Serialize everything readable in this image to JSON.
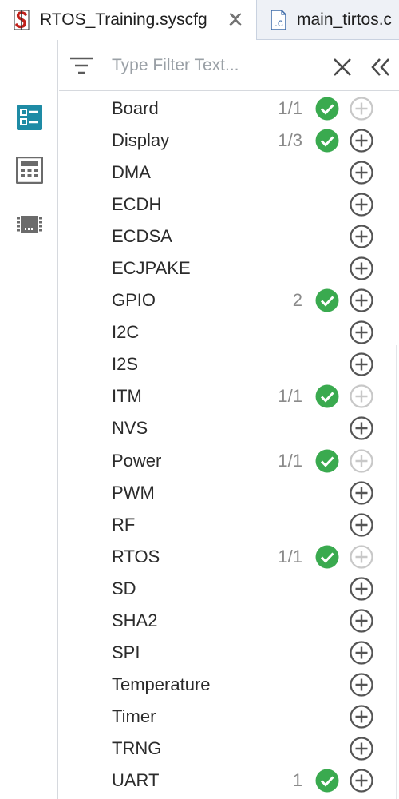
{
  "tabs": [
    {
      "label": "RTOS_Training.syscfg",
      "icon": "syscfg-file-icon",
      "active": true
    },
    {
      "label": "main_tirtos.c",
      "icon": "c-file-icon",
      "active": false
    }
  ],
  "sidebar": {
    "items": [
      {
        "icon": "software-list-icon",
        "active": true,
        "color": "#1e8ba5"
      },
      {
        "icon": "calculator-icon",
        "active": false,
        "color": "#6b6b6b"
      },
      {
        "icon": "chip-icon",
        "active": false,
        "color": "#6b6b6b"
      }
    ]
  },
  "filter": {
    "placeholder": "Type Filter Text...",
    "value": ""
  },
  "colors": {
    "check_green": "#3aaa4f",
    "add_enabled": "#555555",
    "add_disabled": "#c8c8c8",
    "accent": "#1e8ba5"
  },
  "modules": [
    {
      "name": "Board",
      "count": "1/1",
      "added": true,
      "can_add": false
    },
    {
      "name": "Display",
      "count": "1/3",
      "added": true,
      "can_add": true
    },
    {
      "name": "DMA",
      "count": "",
      "added": false,
      "can_add": true
    },
    {
      "name": "ECDH",
      "count": "",
      "added": false,
      "can_add": true
    },
    {
      "name": "ECDSA",
      "count": "",
      "added": false,
      "can_add": true
    },
    {
      "name": "ECJPAKE",
      "count": "",
      "added": false,
      "can_add": true
    },
    {
      "name": "GPIO",
      "count": "2",
      "added": true,
      "can_add": true
    },
    {
      "name": "I2C",
      "count": "",
      "added": false,
      "can_add": true
    },
    {
      "name": "I2S",
      "count": "",
      "added": false,
      "can_add": true
    },
    {
      "name": "ITM",
      "count": "1/1",
      "added": true,
      "can_add": false
    },
    {
      "name": "NVS",
      "count": "",
      "added": false,
      "can_add": true
    },
    {
      "name": "Power",
      "count": "1/1",
      "added": true,
      "can_add": false
    },
    {
      "name": "PWM",
      "count": "",
      "added": false,
      "can_add": true
    },
    {
      "name": "RF",
      "count": "",
      "added": false,
      "can_add": true
    },
    {
      "name": "RTOS",
      "count": "1/1",
      "added": true,
      "can_add": false
    },
    {
      "name": "SD",
      "count": "",
      "added": false,
      "can_add": true
    },
    {
      "name": "SHA2",
      "count": "",
      "added": false,
      "can_add": true
    },
    {
      "name": "SPI",
      "count": "",
      "added": false,
      "can_add": true
    },
    {
      "name": "Temperature",
      "count": "",
      "added": false,
      "can_add": true
    },
    {
      "name": "Timer",
      "count": "",
      "added": false,
      "can_add": true
    },
    {
      "name": "TRNG",
      "count": "",
      "added": false,
      "can_add": true
    },
    {
      "name": "UART",
      "count": "1",
      "added": true,
      "can_add": true
    }
  ]
}
